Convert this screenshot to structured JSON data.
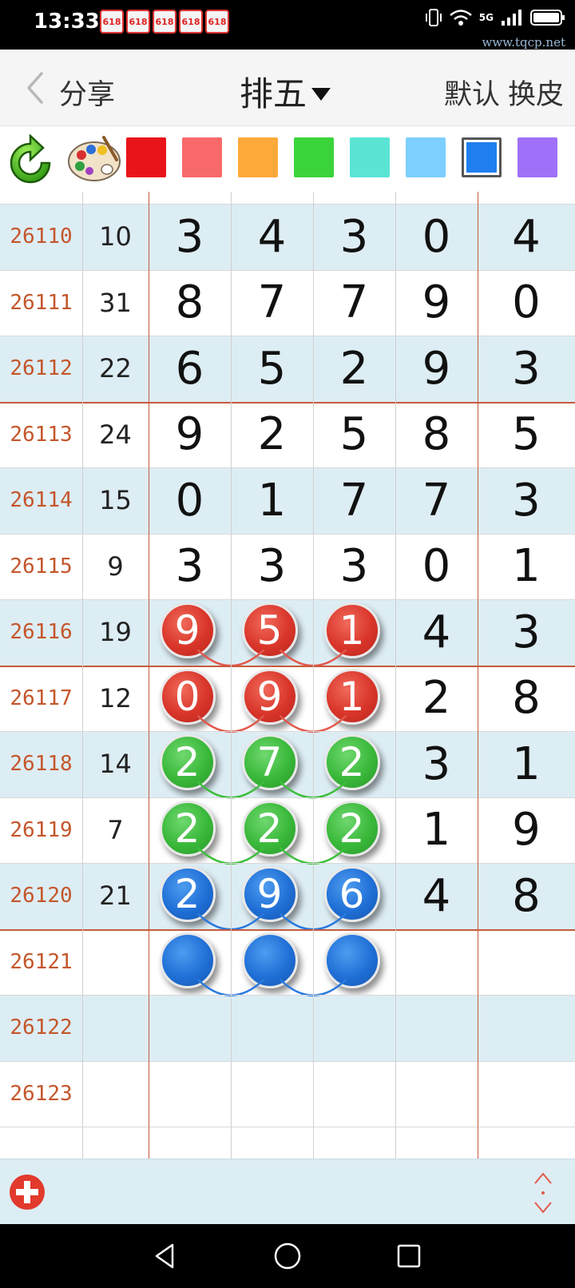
{
  "status_bar": {
    "time": "13:33",
    "notifications": [
      "618",
      "618",
      "618",
      "618",
      "618"
    ],
    "network": "5G",
    "watermark": "www.tqcp.net"
  },
  "title_bar": {
    "share_label": "分享",
    "lottery_name": "排五",
    "default_label": "默认",
    "skin_label": "换皮"
  },
  "palette": {
    "colors": [
      "#e8141a",
      "#f86a6a",
      "#fca93a",
      "#3ad43a",
      "#5ae4d4",
      "#7ccfff",
      "#1f7fef",
      "#a070f8"
    ],
    "selected_index": 6
  },
  "rows": [
    {
      "issue": "26110",
      "sum": "10",
      "digits": [
        "3",
        "4",
        "3",
        "0",
        "4"
      ]
    },
    {
      "issue": "26111",
      "sum": "31",
      "digits": [
        "8",
        "7",
        "7",
        "9",
        "0"
      ]
    },
    {
      "issue": "26112",
      "sum": "22",
      "digits": [
        "6",
        "5",
        "2",
        "9",
        "3"
      ]
    },
    {
      "issue": "26113",
      "sum": "24",
      "digits": [
        "9",
        "2",
        "5",
        "8",
        "5"
      ]
    },
    {
      "issue": "26114",
      "sum": "15",
      "digits": [
        "0",
        "1",
        "7",
        "7",
        "3"
      ]
    },
    {
      "issue": "26115",
      "sum": "9",
      "digits": [
        "3",
        "3",
        "3",
        "0",
        "1"
      ]
    },
    {
      "issue": "26116",
      "sum": "19",
      "digits": [
        "9",
        "5",
        "1",
        "4",
        "3"
      ],
      "ball_color": "red"
    },
    {
      "issue": "26117",
      "sum": "12",
      "digits": [
        "0",
        "9",
        "1",
        "2",
        "8"
      ],
      "ball_color": "red"
    },
    {
      "issue": "26118",
      "sum": "14",
      "digits": [
        "2",
        "7",
        "2",
        "3",
        "1"
      ],
      "ball_color": "green"
    },
    {
      "issue": "26119",
      "sum": "7",
      "digits": [
        "2",
        "2",
        "2",
        "1",
        "9"
      ],
      "ball_color": "green"
    },
    {
      "issue": "26120",
      "sum": "21",
      "digits": [
        "2",
        "9",
        "6",
        "4",
        "8"
      ],
      "ball_color": "blue"
    },
    {
      "issue": "26121",
      "sum": "",
      "digits": [
        "",
        "",
        "",
        "",
        ""
      ],
      "ball_color": "blue"
    },
    {
      "issue": "26122",
      "sum": "",
      "digits": [
        "",
        "",
        "",
        "",
        ""
      ]
    },
    {
      "issue": "26123",
      "sum": "",
      "digits": [
        "",
        "",
        "",
        "",
        ""
      ]
    }
  ]
}
